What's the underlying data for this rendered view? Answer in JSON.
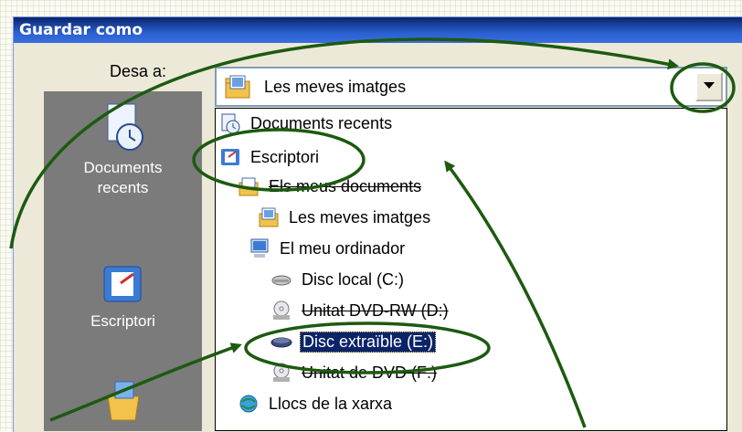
{
  "dialog": {
    "title": "Guardar como",
    "save_in_label": "Desa a:",
    "combo_value": "Les meves imatges",
    "places": [
      {
        "label_line1": "Documents",
        "label_line2": "recents",
        "icon": "recent-documents-icon"
      },
      {
        "label_line1": "Escriptori",
        "label_line2": "",
        "icon": "desktop-icon"
      }
    ],
    "dropdown_items": [
      {
        "label": "Documents recents",
        "icon": "recent-documents-icon"
      },
      {
        "label": "Escriptori",
        "icon": "desktop-icon"
      },
      {
        "label": "Els meus documents",
        "icon": "folder-icon"
      },
      {
        "label": "Les meves imatges",
        "icon": "pictures-folder-icon"
      },
      {
        "label": "El meu ordinador",
        "icon": "computer-icon"
      },
      {
        "label": "Disc local (C:)",
        "icon": "hard-drive-icon"
      },
      {
        "label": "Unitat DVD-RW (D:)",
        "icon": "dvd-drive-icon"
      },
      {
        "label": "Disc extraïble (E:)",
        "icon": "removable-disk-icon",
        "selected": true
      },
      {
        "label": "Unitat de DVD (F:)",
        "icon": "dvd-drive-icon"
      },
      {
        "label": "Llocs de la xarxa",
        "icon": "network-places-icon"
      }
    ]
  },
  "colors": {
    "title_bar": "#2a5fd0",
    "annotation": "#1d5a10",
    "selection": "#0a246a",
    "places_bar": "#7b7b7b"
  }
}
